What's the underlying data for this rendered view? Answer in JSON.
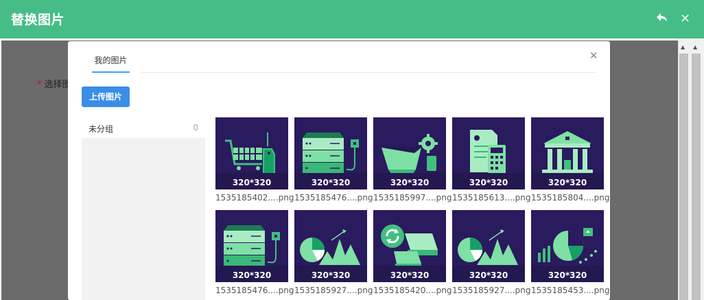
{
  "header": {
    "title": "替换图片",
    "back_icon": "reply-arrow-icon",
    "close_icon": "close-icon"
  },
  "background": {
    "field_label": "选择图",
    "required_mark": "*"
  },
  "modal": {
    "tabs": [
      {
        "label": "我的图片",
        "active": true
      }
    ],
    "close_icon": "close-icon",
    "upload_button": "上传图片",
    "groups": [
      {
        "name": "未分组",
        "count": "0"
      }
    ],
    "images": [
      {
        "size": "320*320",
        "filename": "1535185402....png",
        "icon": "shopping-cart-icon"
      },
      {
        "size": "320*320",
        "filename": "1535185476....png",
        "icon": "server-rack-icon"
      },
      {
        "size": "320*320",
        "filename": "1535185997....png",
        "icon": "mining-cart-gear-icon"
      },
      {
        "size": "320*320",
        "filename": "1535185613....png",
        "icon": "invoice-calculator-icon"
      },
      {
        "size": "320*320",
        "filename": "1535185804....png",
        "icon": "bank-building-icon"
      },
      {
        "size": "320*320",
        "filename": "1535185476....png",
        "icon": "server-rack-icon"
      },
      {
        "size": "320*320",
        "filename": "1535185927....png",
        "icon": "pie-mountain-chart-icon"
      },
      {
        "size": "320*320",
        "filename": "1535185420....png",
        "icon": "refresh-database-icon"
      },
      {
        "size": "320*320",
        "filename": "1535185927....png",
        "icon": "pie-mountain-chart-icon"
      },
      {
        "size": "320*320",
        "filename": "1535185453....png",
        "icon": "bar-pie-scatter-chart-icon"
      }
    ]
  },
  "colors": {
    "header": "#46bd86",
    "thumb_bg": "#2a1a5e",
    "accent_green": "#40c080",
    "primary": "#3a8ee6"
  }
}
